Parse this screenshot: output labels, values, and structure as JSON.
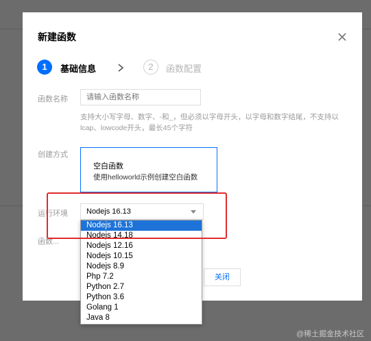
{
  "dialog": {
    "title": "新建函数",
    "close_icon": "close-icon"
  },
  "steps": [
    {
      "number": "1",
      "label": "基础信息",
      "state": "active"
    },
    {
      "number": "2",
      "label": "函数配置",
      "state": "inactive"
    }
  ],
  "form": {
    "function_name": {
      "label": "函数名称",
      "placeholder": "请输入函数名称",
      "help": "支持大小写字母、数字、-和_，但必须以字母开头，以字母和数字结尾，不支持以lcap、lowcode开头，最长45个字符"
    },
    "create_method": {
      "label": "创建方式",
      "option_title": "空白函数",
      "option_desc": "使用helloworld示例创建空白函数"
    },
    "runtime": {
      "label": "运行环境",
      "value": "Nodejs 16.13",
      "options": [
        "Nodejs 16.13",
        "Nodejs 14.18",
        "Nodejs 12.16",
        "Nodejs 10.15",
        "Nodejs 8.9",
        "Php 7.2",
        "Python 2.7",
        "Python 3.6",
        "Golang 1",
        "Java 8"
      ]
    },
    "hidden_label": "函数..."
  },
  "footer": {
    "close_label": "关闭"
  },
  "watermark": "@稀土掘金技术社区",
  "colors": {
    "accent": "#006eff",
    "selected": "#1e73d8",
    "annotation": "#e02a2a"
  }
}
